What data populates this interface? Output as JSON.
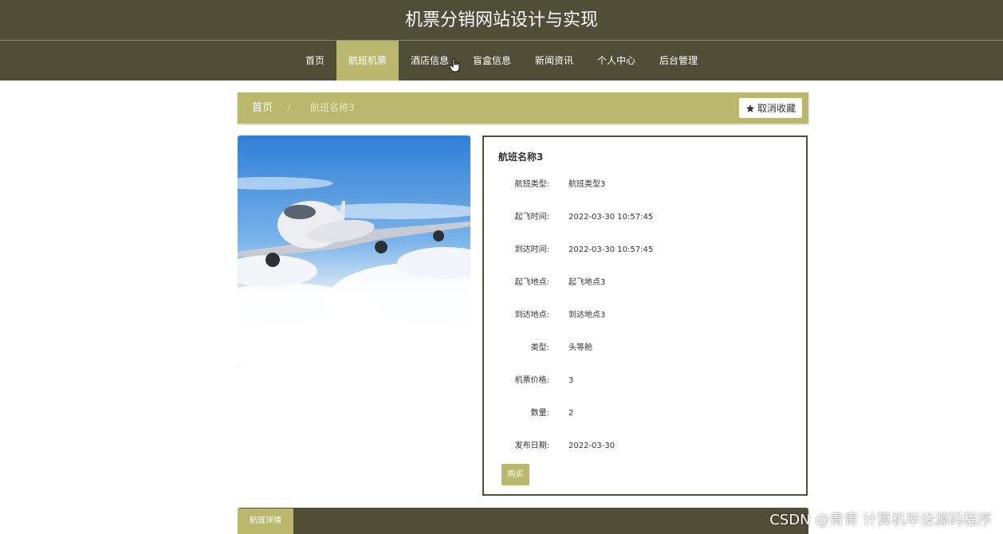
{
  "site": {
    "title": "机票分销网站设计与实现"
  },
  "nav": {
    "items": [
      {
        "label": "首页"
      },
      {
        "label": "航班机票"
      },
      {
        "label": "酒店信息"
      },
      {
        "label": "盲盒信息"
      },
      {
        "label": "新闻资讯"
      },
      {
        "label": "个人中心"
      },
      {
        "label": "后台管理"
      }
    ],
    "active_index": 1
  },
  "breadcrumb": {
    "home": "首页",
    "separator": "/",
    "current": "航班名称3"
  },
  "favorite_button": {
    "label": "取消收藏",
    "icon": "star-icon"
  },
  "detail": {
    "title": "航班名称3",
    "rows": [
      {
        "label": "航班类型:",
        "value": "航班类型3"
      },
      {
        "label": "起飞时间:",
        "value": "2022-03-30 10:57:45"
      },
      {
        "label": "到达时间:",
        "value": "2022-03-30 10:57:45"
      },
      {
        "label": "起飞地点:",
        "value": "起飞地点3"
      },
      {
        "label": "到达地点:",
        "value": "到达地点3"
      },
      {
        "label": "类型:",
        "value": "头等舱"
      },
      {
        "label": "机票价格:",
        "value": "3"
      },
      {
        "label": "数量:",
        "value": "2"
      },
      {
        "label": "发布日期:",
        "value": "2022-03-30"
      }
    ],
    "buy_label": "购买"
  },
  "tabs": [
    {
      "label": "航班详情"
    }
  ],
  "watermark": "CSDN @青青 计算机毕设源码程序",
  "colors": {
    "header": "#4f4e36",
    "accent": "#b9b86d"
  }
}
